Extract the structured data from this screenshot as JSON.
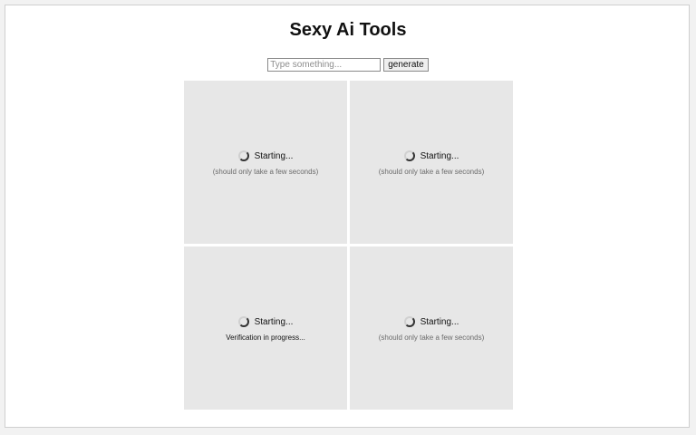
{
  "header": {
    "title": "Sexy Ai Tools"
  },
  "prompt": {
    "placeholder": "Type something...",
    "value": "",
    "button_label": "generate"
  },
  "tiles": [
    {
      "status": "Starting...",
      "note": "(should only take a few seconds)"
    },
    {
      "status": "Starting...",
      "note": "(should only take a few seconds)"
    },
    {
      "status": "Starting...",
      "note": "Verification in progress..."
    },
    {
      "status": "Starting...",
      "note": "(should only take a few seconds)"
    }
  ],
  "colors": {
    "tile_bg": "#e7e7e7",
    "page_bg": "#ffffff",
    "note_grey": "#6b6b6b"
  },
  "icons": {
    "loading": "spinner-icon"
  }
}
